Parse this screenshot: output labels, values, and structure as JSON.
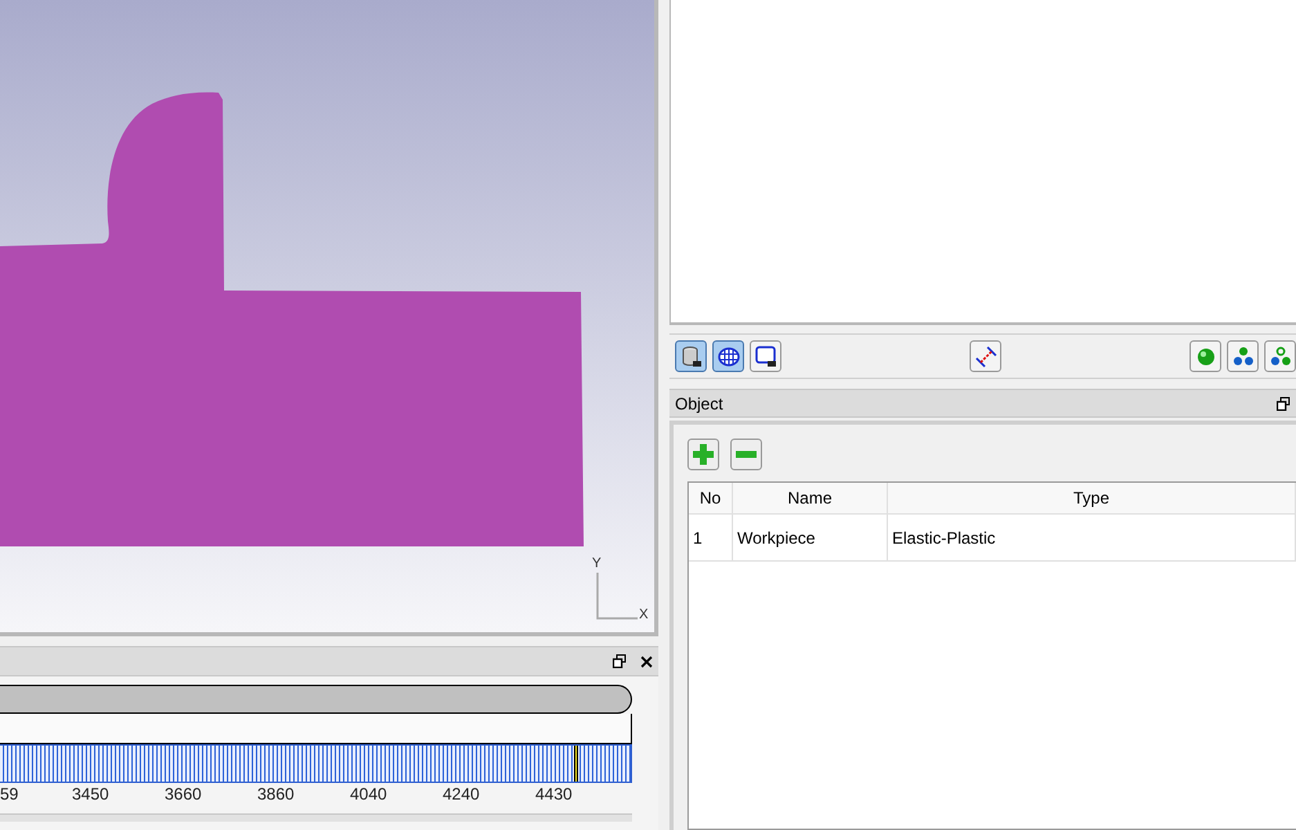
{
  "viewport": {
    "axis_labels": {
      "y": "Y",
      "x": "X"
    }
  },
  "timeline_panel": {
    "ticks": [
      "59",
      "3450",
      "3660",
      "3860",
      "4040",
      "4240",
      "4430"
    ],
    "level": 0.91
  },
  "toolbar": {
    "buttons": [
      {
        "kind": "cylinder",
        "selected": true
      },
      {
        "kind": "grid",
        "selected": true
      },
      {
        "kind": "monitor",
        "selected": false
      },
      {
        "kind": "measure",
        "selected": false
      },
      {
        "kind": "sphere",
        "selected": false
      },
      {
        "kind": "cluster",
        "selected": false
      },
      {
        "kind": "cluster-outline",
        "selected": false
      }
    ]
  },
  "object_panel": {
    "title": "Object",
    "columns": [
      "No",
      "Name",
      "Type"
    ],
    "rows": [
      [
        "1",
        "Workpiece",
        "Elastic-Plastic"
      ]
    ]
  }
}
